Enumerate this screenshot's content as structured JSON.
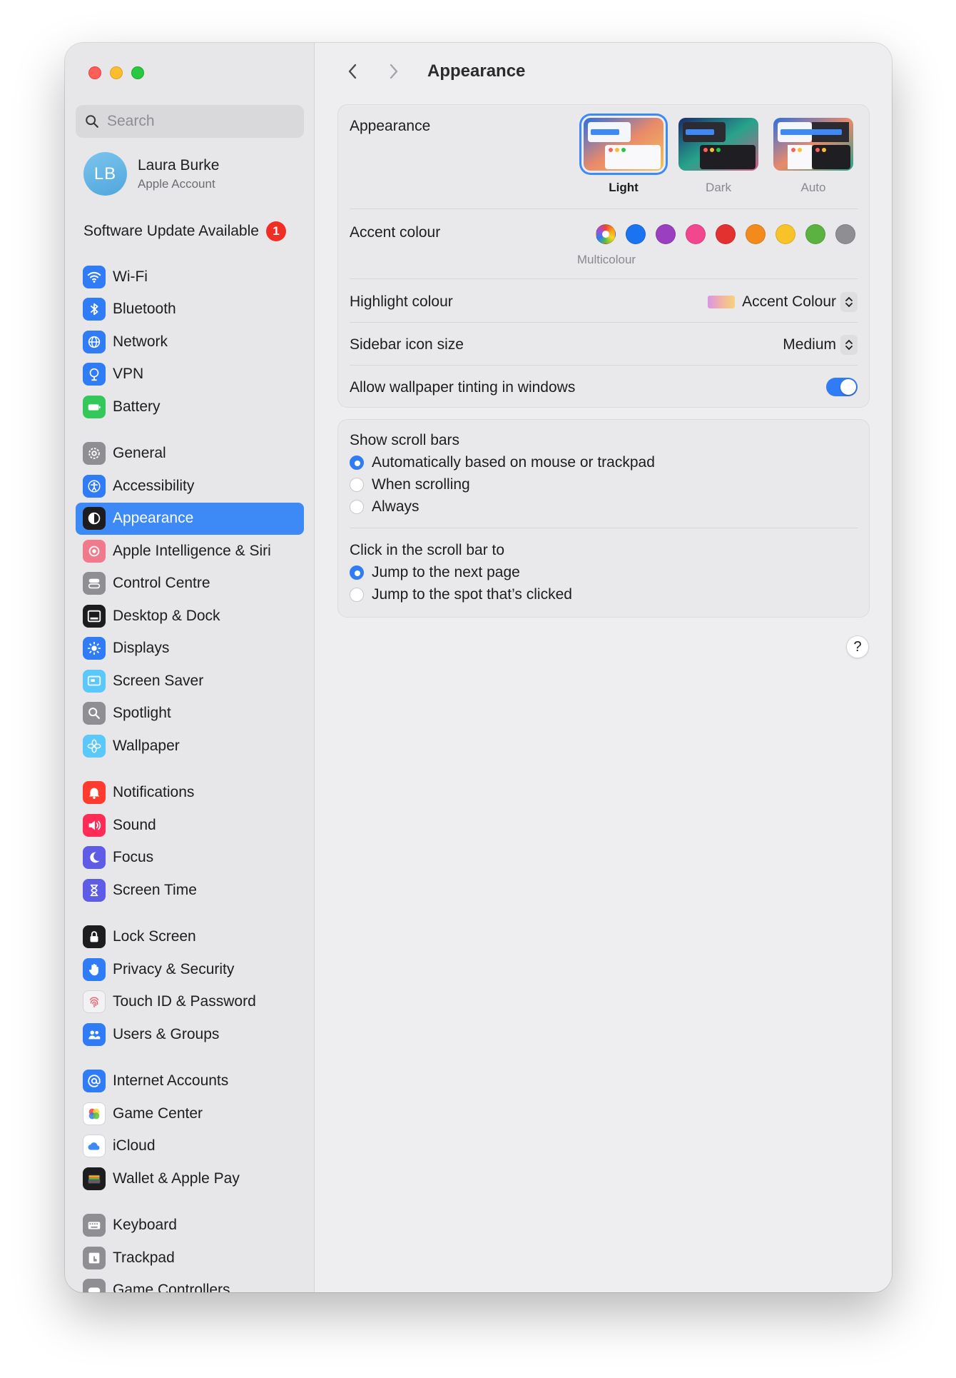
{
  "sidebar": {
    "search_placeholder": "Search",
    "account": {
      "initials": "LB",
      "name": "Laura Burke",
      "subtitle": "Apple Account"
    },
    "update": {
      "label": "Software Update Available",
      "count": "1"
    },
    "groups": [
      [
        {
          "label": "Wi-Fi",
          "icon": "wifi-icon",
          "color": "#2f7cf6"
        },
        {
          "label": "Bluetooth",
          "icon": "bluetooth-icon",
          "color": "#2f7cf6"
        },
        {
          "label": "Network",
          "icon": "globe-icon",
          "color": "#2f7cf6"
        },
        {
          "label": "VPN",
          "icon": "vpn-icon",
          "color": "#2f7cf6"
        },
        {
          "label": "Battery",
          "icon": "battery-icon",
          "color": "#34c759"
        }
      ],
      [
        {
          "label": "General",
          "icon": "gear-icon",
          "color": "#8e8e93"
        },
        {
          "label": "Accessibility",
          "icon": "accessibility-icon",
          "color": "#2f7cf6"
        },
        {
          "label": "Appearance",
          "icon": "appearance-icon",
          "color": "#1d1d1f",
          "active": true
        },
        {
          "label": "Apple Intelligence & Siri",
          "icon": "siri-icon",
          "color": "#f07a8c"
        },
        {
          "label": "Control Centre",
          "icon": "control-centre-icon",
          "color": "#8e8e93"
        },
        {
          "label": "Desktop & Dock",
          "icon": "dock-icon",
          "color": "#1d1d1f"
        },
        {
          "label": "Displays",
          "icon": "sun-icon",
          "color": "#2f7cf6"
        },
        {
          "label": "Screen Saver",
          "icon": "screen-saver-icon",
          "color": "#5ac8fa"
        },
        {
          "label": "Spotlight",
          "icon": "spotlight-icon",
          "color": "#8e8e93"
        },
        {
          "label": "Wallpaper",
          "icon": "flower-icon",
          "color": "#5ac8fa"
        }
      ],
      [
        {
          "label": "Notifications",
          "icon": "bell-icon",
          "color": "#ff3b30"
        },
        {
          "label": "Sound",
          "icon": "speaker-icon",
          "color": "#ff2d55"
        },
        {
          "label": "Focus",
          "icon": "moon-icon",
          "color": "#5e5ce6"
        },
        {
          "label": "Screen Time",
          "icon": "hourglass-icon",
          "color": "#5e5ce6"
        }
      ],
      [
        {
          "label": "Lock Screen",
          "icon": "lock-icon",
          "color": "#1d1d1f"
        },
        {
          "label": "Privacy & Security",
          "icon": "hand-icon",
          "color": "#2f7cf6"
        },
        {
          "label": "Touch ID & Password",
          "icon": "fingerprint-icon",
          "color": "#f2f2f4"
        },
        {
          "label": "Users & Groups",
          "icon": "users-icon",
          "color": "#2f7cf6"
        }
      ],
      [
        {
          "label": "Internet Accounts",
          "icon": "at-icon",
          "color": "#2f7cf6"
        },
        {
          "label": "Game Center",
          "icon": "game-center-icon",
          "color": "#ffffff"
        },
        {
          "label": "iCloud",
          "icon": "cloud-icon",
          "color": "#ffffff"
        },
        {
          "label": "Wallet & Apple Pay",
          "icon": "wallet-icon",
          "color": "#1d1d1f"
        }
      ],
      [
        {
          "label": "Keyboard",
          "icon": "keyboard-icon",
          "color": "#8e8e93"
        },
        {
          "label": "Trackpad",
          "icon": "trackpad-icon",
          "color": "#8e8e93"
        },
        {
          "label": "Game Controllers",
          "icon": "controller-icon",
          "color": "#8e8e93"
        }
      ]
    ]
  },
  "header": {
    "title": "Appearance"
  },
  "appearance": {
    "label": "Appearance",
    "modes": [
      {
        "label": "Light",
        "selected": true
      },
      {
        "label": "Dark",
        "selected": false
      },
      {
        "label": "Auto",
        "selected": false
      }
    ]
  },
  "accent": {
    "label": "Accent colour",
    "selected_label": "Multicolour",
    "colors": [
      "multicolour",
      "#1a73f0",
      "#9a3fc0",
      "#f2468f",
      "#e2312f",
      "#f28a1c",
      "#f7c328",
      "#5bb240",
      "#8e8e93"
    ]
  },
  "highlight": {
    "label": "Highlight colour",
    "value": "Accent Colour"
  },
  "sidebar_icon_size": {
    "label": "Sidebar icon size",
    "value": "Medium"
  },
  "wallpaper_tinting": {
    "label": "Allow wallpaper tinting in windows",
    "on": true
  },
  "scroll_bars": {
    "title": "Show scroll bars",
    "options": [
      {
        "label": "Automatically based on mouse or trackpad",
        "selected": true
      },
      {
        "label": "When scrolling",
        "selected": false
      },
      {
        "label": "Always",
        "selected": false
      }
    ]
  },
  "click_scroll": {
    "title": "Click in the scroll bar to",
    "options": [
      {
        "label": "Jump to the next page",
        "selected": true
      },
      {
        "label": "Jump to the spot that’s clicked",
        "selected": false
      }
    ]
  },
  "help_label": "?"
}
